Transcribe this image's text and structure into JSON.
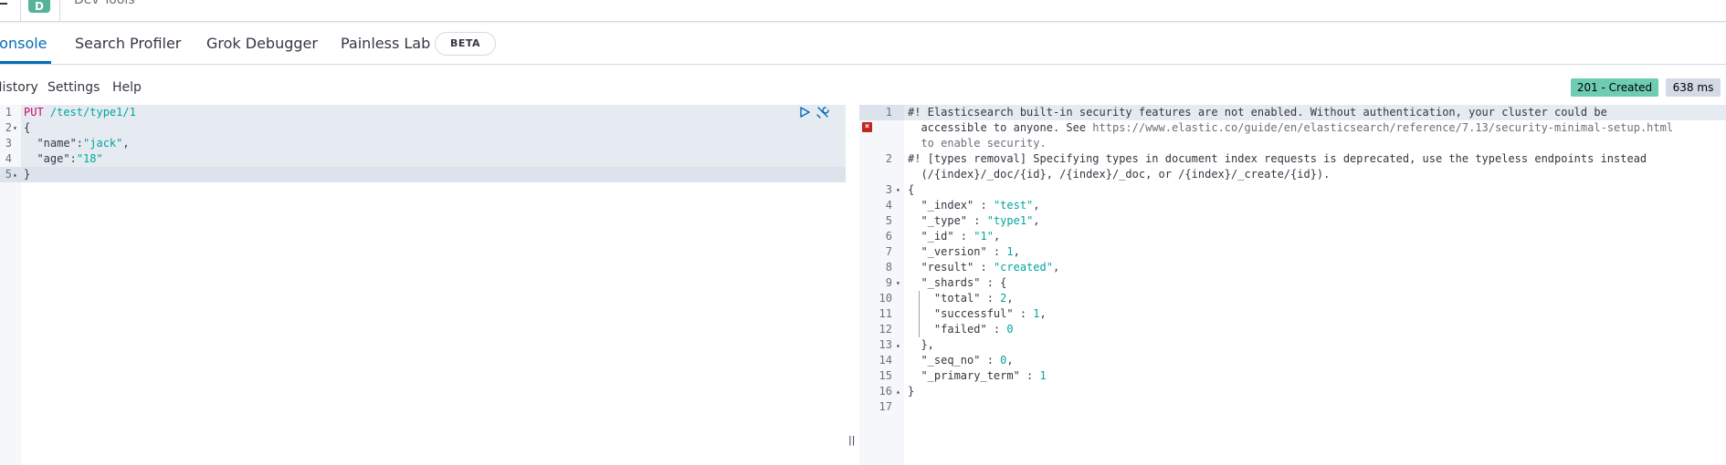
{
  "header": {
    "space_initial": "D",
    "app_title": "Dev Tools"
  },
  "tabs": [
    {
      "label": "Console"
    },
    {
      "label": "Search Profiler"
    },
    {
      "label": "Grok Debugger"
    },
    {
      "label": "Painless Lab"
    }
  ],
  "beta_label": "BETA",
  "console_menu": {
    "history": "History",
    "settings": "Settings",
    "help": "Help"
  },
  "status": {
    "code": "201 - Created",
    "time": "638 ms"
  },
  "colors": {
    "accent": "#006bb8",
    "status_success": "#6dccb1",
    "method": "#c80a68",
    "string": "#00a69b",
    "error": "#bd271e"
  },
  "editor": {
    "lines": [
      {
        "n": "1",
        "method": "PUT",
        "url": " /test/type1/1"
      },
      {
        "n": "2",
        "text": "{"
      },
      {
        "n": "3",
        "key": "  \"name\"",
        "sep": ":",
        "val": "\"jack\"",
        "end": ","
      },
      {
        "n": "4",
        "key": "  \"age\"",
        "sep": ":",
        "val": "\"18\"",
        "end": ""
      },
      {
        "n": "5",
        "text": "}"
      }
    ]
  },
  "output": {
    "warning1_a": "#! Elasticsearch built-in security features are not enabled. Without authentication, your cluster could be",
    "warning1_b_pre": "  accessible to anyone. See ",
    "warning1_b_url": "https://www.elastic.co/guide/en/elasticsearch/reference/7.13/security-minimal-setup.html",
    "warning1_c": "  to enable security.",
    "warning2_a": "#! [types removal] Specifying types in document index requests is deprecated, use the typeless endpoints instead",
    "warning2_b": "  (/{index}/_doc/{id}, /{index}/_doc, or /{index}/_create/{id}).",
    "line_numbers": [
      "1",
      "2",
      "3",
      "4",
      "5",
      "6",
      "7",
      "8",
      "9",
      "10",
      "11",
      "12",
      "13",
      "14",
      "15",
      "16",
      "17"
    ],
    "json": {
      "open": "{",
      "index_key": "  \"_index\"",
      "index_val": "\"test\"",
      "type_key": "  \"_type\"",
      "type_val": "\"type1\"",
      "id_key": "  \"_id\"",
      "id_val": "\"1\"",
      "version_key": "  \"_version\"",
      "version_val": "1",
      "result_key": "  \"result\"",
      "result_val": "\"created\"",
      "shards_key": "  \"_shards\"",
      "total_key": "    \"total\"",
      "total_val": "2",
      "successful_key": "    \"successful\"",
      "successful_val": "1",
      "failed_key": "    \"failed\"",
      "failed_val": "0",
      "shards_close": "  },",
      "seq_key": "  \"_seq_no\"",
      "seq_val": "0",
      "term_key": "  \"_primary_term\"",
      "term_val": "1",
      "close": "}"
    }
  }
}
